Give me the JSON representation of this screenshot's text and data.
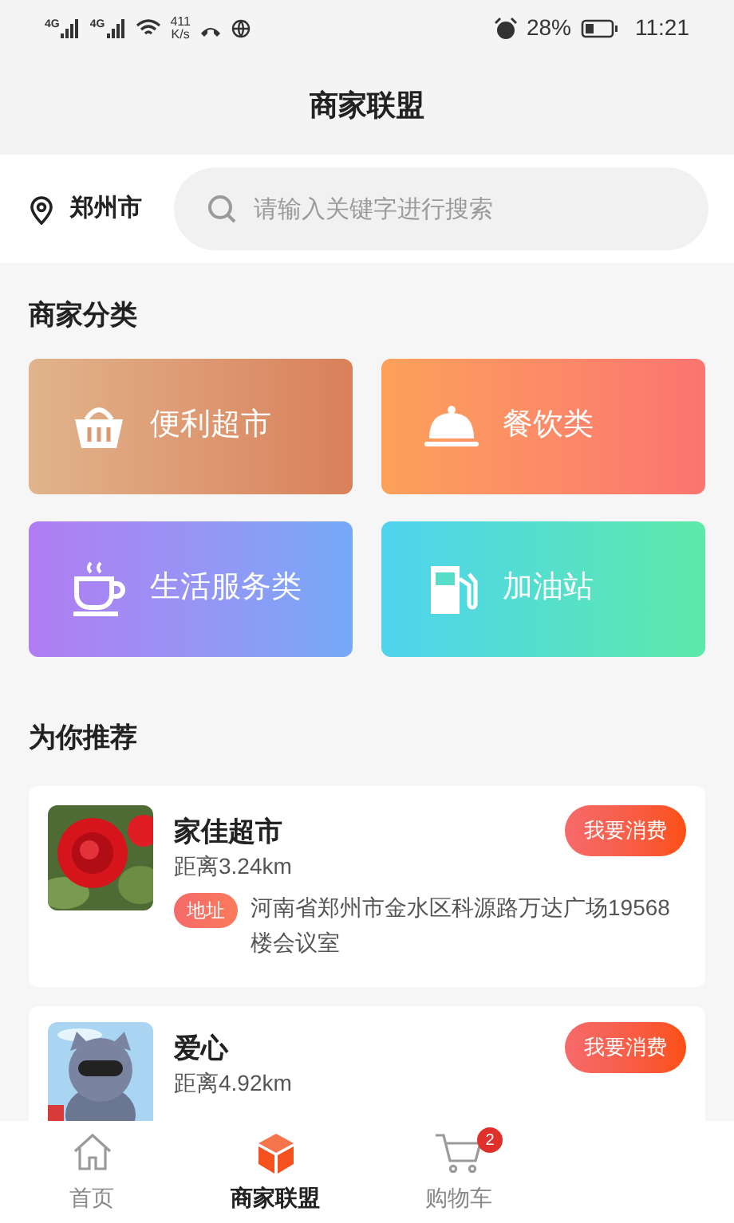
{
  "status_bar": {
    "network_1": "4G",
    "network_2": "4G",
    "speed_value": "411",
    "speed_unit": "K/s",
    "battery": "28%",
    "time": "11:21"
  },
  "header": {
    "title": "商家联盟"
  },
  "location": {
    "city": "郑州市"
  },
  "search": {
    "placeholder": "请输入关键字进行搜索"
  },
  "categories": {
    "title": "商家分类",
    "items": [
      {
        "label": "便利超市",
        "kind": "basket"
      },
      {
        "label": "餐饮类",
        "kind": "cloche"
      },
      {
        "label": "生活服务类",
        "kind": "cup"
      },
      {
        "label": "加油站",
        "kind": "fuel"
      }
    ]
  },
  "recommend": {
    "title": "为你推荐",
    "shops": [
      {
        "name": "家佳超市",
        "distance": "距离3.24km",
        "address_tag": "地址",
        "address": "河南省郑州市金水区科源路万达广场19568楼会议室",
        "action": "我要消费"
      },
      {
        "name": "爱心",
        "distance": "距离4.92km",
        "action": "我要消费"
      }
    ]
  },
  "tab_bar": [
    {
      "label": "首页",
      "kind": "home",
      "selected": false
    },
    {
      "label": "商家联盟",
      "kind": "cube",
      "selected": true
    },
    {
      "label": "购物车",
      "kind": "cart",
      "selected": false,
      "badge": "2"
    }
  ]
}
